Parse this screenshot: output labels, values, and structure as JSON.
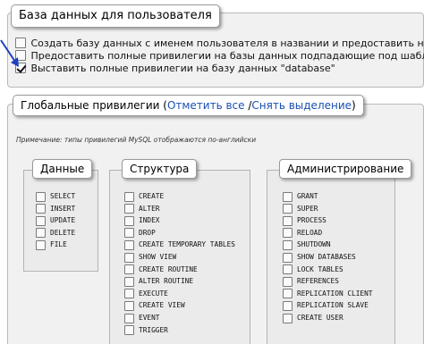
{
  "user_db": {
    "legend": "База данных для пользователя",
    "options": [
      {
        "label": "Создать базу данных с именем пользователя в названии и предоставить на нее полные привилегии",
        "checked": false
      },
      {
        "label": "Предоставить полные привилегии на базы данных подпадающие под шаблон (имя пользователя\\_%)",
        "checked": false
      },
      {
        "label": "Выставить полные привилегии на базу данных \"database\"",
        "checked": true
      }
    ]
  },
  "global": {
    "legend_prefix": "Глобальные привилегии (",
    "check_all": "Отметить все",
    "sep": " /",
    "uncheck_all": "Снять выделение",
    "legend_suffix": ")",
    "note": "Примечание: типы привилегий MySQL отображаются по-английски",
    "groups": {
      "data": {
        "legend": "Данные",
        "items": [
          "SELECT",
          "INSERT",
          "UPDATE",
          "DELETE",
          "FILE"
        ]
      },
      "structure": {
        "legend": "Структура",
        "items": [
          "CREATE",
          "ALTER",
          "INDEX",
          "DROP",
          "CREATE TEMPORARY TABLES",
          "SHOW VIEW",
          "CREATE ROUTINE",
          "ALTER ROUTINE",
          "EXECUTE",
          "CREATE VIEW",
          "EVENT",
          "TRIGGER"
        ]
      },
      "admin": {
        "legend": "Администрирование",
        "items": [
          "GRANT",
          "SUPER",
          "PROCESS",
          "RELOAD",
          "SHUTDOWN",
          "SHOW DATABASES",
          "LOCK TABLES",
          "REFERENCES",
          "REPLICATION CLIENT",
          "REPLICATION SLAVE",
          "CREATE USER"
        ]
      }
    }
  },
  "colors": {
    "annotation_arrow": "#1f3fbf",
    "link": "#1a4fb4"
  }
}
